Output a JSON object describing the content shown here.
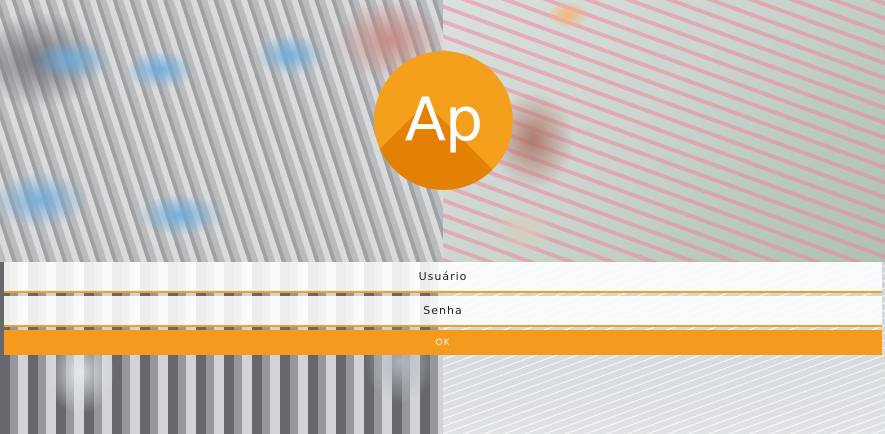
{
  "logo": {
    "text": "Ap",
    "color": "#f5a01d"
  },
  "login": {
    "username_placeholder": "Usuário",
    "username_value": "",
    "password_placeholder": "Senha",
    "password_value": "",
    "submit_label": "OK",
    "accent_color": "#f49a1c"
  }
}
